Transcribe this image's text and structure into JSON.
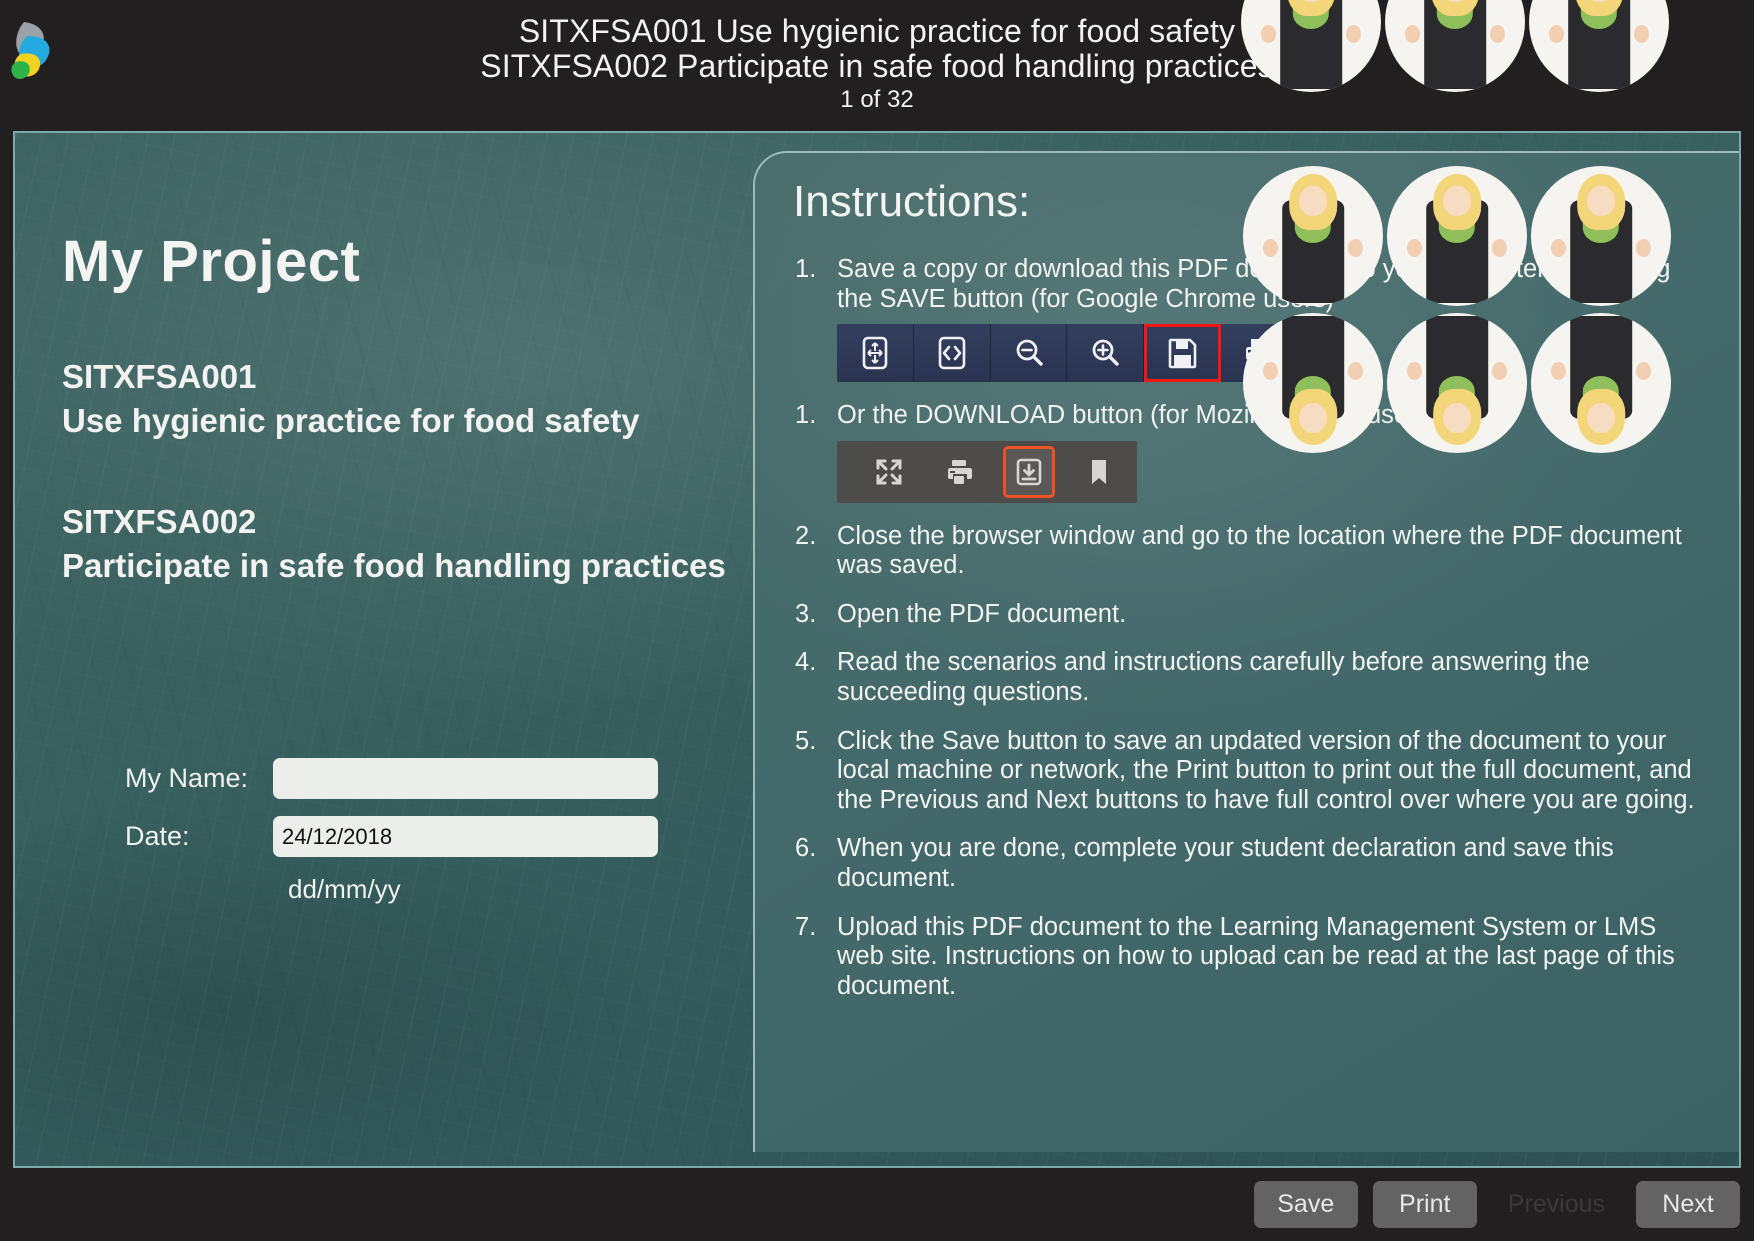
{
  "header": {
    "logo_icon": "leaf-logo-icon",
    "line1": "SITXFSA001  Use hygienic practice for food safety",
    "line2": "SITXFSA002  Participate in safe food handling practices",
    "page_indicator": "1 of 32"
  },
  "slide": {
    "project_title": "My Project",
    "units": [
      {
        "code": "SITXFSA001",
        "name": "Use hygienic practice for food safety"
      },
      {
        "code": "SITXFSA002",
        "name": "Participate in safe food handling practices"
      }
    ],
    "form": {
      "name_label": "My Name:",
      "name_value": "",
      "name_placeholder": "",
      "date_label": "Date:",
      "date_value": "24/12/2018",
      "date_hint": "dd/mm/yy"
    }
  },
  "instructions": {
    "title": "Instructions:",
    "items": [
      {
        "text": "Save a copy or download this PDF document to your computer by clicking the SAVE button (for Google Chrome users)",
        "toolbar": "chrome"
      },
      {
        "text": "Or the DOWNLOAD button (for Mozilla Firefox users)",
        "toolbar": "firefox",
        "unnumbered": true
      },
      {
        "text": "Close the browser window and go to the location where the PDF document was saved."
      },
      {
        "text": "Open the PDF document."
      },
      {
        "text": "Read the scenarios and instructions carefully before answering the succeeding questions."
      },
      {
        "text": "Click the Save button to save an updated version of the document to your local machine or network,  the Print button to print out the full document, and the Previous and Next buttons to have full control over where you are going."
      },
      {
        "text": "When you are done, complete your student declaration and save this document."
      },
      {
        "text": "Upload this PDF document to the Learning Management System or LMS web site. Instructions on how to upload can be read at the last page of this document."
      }
    ],
    "chrome_toolbar": {
      "buttons": [
        {
          "icon": "fit-page-icon",
          "highlighted": false
        },
        {
          "icon": "fit-width-icon",
          "highlighted": false
        },
        {
          "icon": "zoom-out-icon",
          "highlighted": false
        },
        {
          "icon": "zoom-in-icon",
          "highlighted": false
        },
        {
          "icon": "save-floppy-icon",
          "highlighted": true
        },
        {
          "icon": "print-icon",
          "highlighted": false
        }
      ],
      "highlight_color": "#ff1414"
    },
    "firefox_toolbar": {
      "buttons": [
        {
          "icon": "fullscreen-icon",
          "highlighted": false
        },
        {
          "icon": "print-icon",
          "highlighted": false
        },
        {
          "icon": "download-icon",
          "highlighted": true
        },
        {
          "icon": "bookmark-icon",
          "highlighted": false
        }
      ],
      "highlight_color": "#f05124"
    }
  },
  "footer": {
    "buttons": [
      {
        "label": "Save",
        "disabled": false
      },
      {
        "label": "Print",
        "disabled": false
      },
      {
        "label": "Previous",
        "disabled": true
      },
      {
        "label": "Next",
        "disabled": false
      }
    ]
  },
  "colors": {
    "chrome_bar": "#2b3451",
    "firefox_bar": "#4e4c4a",
    "chalkboard": "#3a6160",
    "app_background": "#211f1f"
  }
}
